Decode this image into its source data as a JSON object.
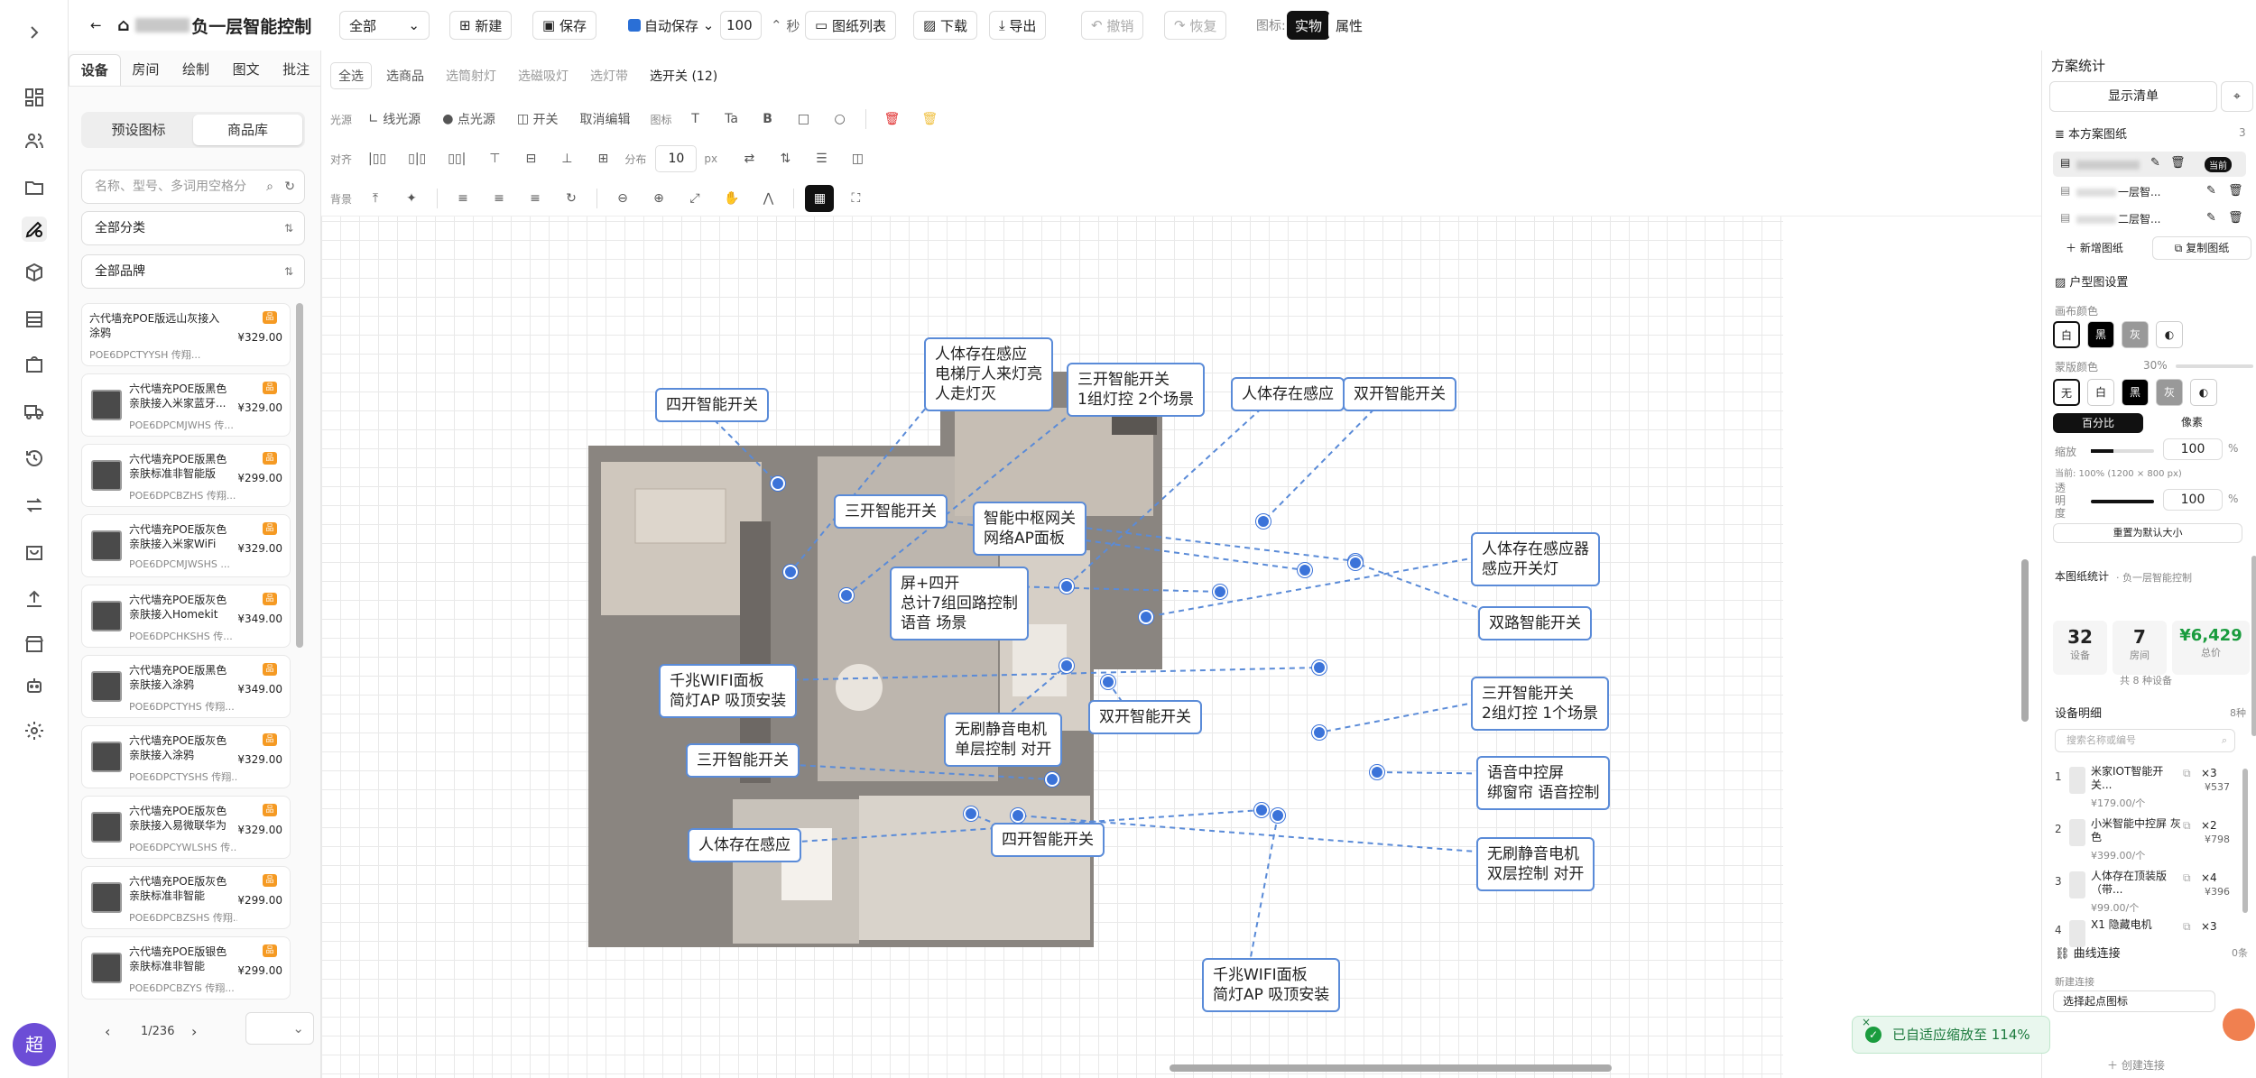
{
  "topbar": {
    "title": "负一层智能控制",
    "floor_select": "全部",
    "new": "新建",
    "save": "保存",
    "autosave": "自动保存",
    "interval": "100",
    "interval_unit": "秒",
    "drawing_list": "图纸列表",
    "download": "下载",
    "export": "导出",
    "undo": "撤销",
    "redo": "恢复",
    "icon_label": "图标:",
    "mode_real": "实物",
    "mode_attr": "属性"
  },
  "left": {
    "tabs": [
      "设备",
      "房间",
      "绘制",
      "图文",
      "批注"
    ],
    "seg": [
      "预设图标",
      "商品库"
    ],
    "search_placeholder": "名称、型号、多词用空格分",
    "category": "全部分类",
    "brand": "全部品牌",
    "page": "1/236",
    "products": [
      {
        "name": "六代墙充POE版远山灰接入涂鸦",
        "sku": "POE6DPCTYYSH 传翔...",
        "price": "¥329.00"
      },
      {
        "name": "六代墙充POE版黑色亲肤接入米家蓝牙...",
        "sku": "POE6DPCMJWHS 传...",
        "price": "¥329.00"
      },
      {
        "name": "六代墙充POE版黑色亲肤标准非智能版",
        "sku": "POE6DPCBZHS 传翔...",
        "price": "¥299.00"
      },
      {
        "name": "六代墙充POE版灰色亲肤接入米家WiFi",
        "sku": "POE6DPCMJWSHS ...",
        "price": "¥329.00"
      },
      {
        "name": "六代墙充POE版灰色亲肤接入Homekit",
        "sku": "POE6DPCHKSHS 传...",
        "price": "¥349.00"
      },
      {
        "name": "六代墙充POE版黑色亲肤接入涂鸦",
        "sku": "POE6DPCTYHS 传翔...",
        "price": "¥349.00"
      },
      {
        "name": "六代墙充POE版灰色亲肤接入涂鸦",
        "sku": "POE6DPCTYSHS 传翔...",
        "price": "¥329.00"
      },
      {
        "name": "六代墙充POE版灰色亲肤接入易微联华为",
        "sku": "POE6DPCYWLSHS 传...",
        "price": "¥329.00"
      },
      {
        "name": "六代墙充POE版灰色亲肤标准非智能",
        "sku": "POE6DPCBZSHS 传翔...",
        "price": "¥299.00"
      },
      {
        "name": "六代墙充POE版银色亲肤标准非智能",
        "sku": "POE6DPCBZYS 传翔...",
        "price": "¥299.00"
      }
    ]
  },
  "toolbar": {
    "r1": [
      "全选",
      "选商品",
      "选筒射灯",
      "选磁吸灯",
      "选灯带",
      "选开关 (12)"
    ],
    "r2": {
      "label": "光源",
      "items": [
        "线光源",
        "点光源",
        "开关",
        "取消编辑"
      ],
      "icon_label": "图标"
    },
    "r3": {
      "label": "对齐",
      "dist": "分布",
      "gap": "10",
      "unit": "px"
    },
    "r4": {
      "label": "背景"
    }
  },
  "labels": [
    {
      "t": "四开智能开关"
    },
    {
      "t": "人体存在感应\n电梯厅人来灯亮\n人走灯灭"
    },
    {
      "t": "三开智能开关\n1组灯控 2个场景"
    },
    {
      "t": "人体存在感应"
    },
    {
      "t": "双开智能开关"
    },
    {
      "t": "三开智能开关"
    },
    {
      "t": "智能中枢网关\n网络AP面板"
    },
    {
      "t": "屏+四开\n总计7组回路控制\n语音 场景"
    },
    {
      "t": "人体存在感应器\n感应开关灯"
    },
    {
      "t": "双路智能开关"
    },
    {
      "t": "千兆WIFI面板\n简灯AP 吸顶安装"
    },
    {
      "t": "三开智能开关\n2组灯控 1个场景"
    },
    {
      "t": "双开智能开关"
    },
    {
      "t": "无刷静音电机\n单层控制 对开"
    },
    {
      "t": "三开智能开关"
    },
    {
      "t": "语音中控屏\n绑窗帘 语音控制"
    },
    {
      "t": "人体存在感应"
    },
    {
      "t": "四开智能开关"
    },
    {
      "t": "无刷静音电机\n双层控制 对开"
    },
    {
      "t": "千兆WIFI面板\n简灯AP 吸顶安装"
    }
  ],
  "right": {
    "title": "方案统计",
    "show_list": "显示清单",
    "drawings": "本方案图纸",
    "drawings_count": "3",
    "current": "当前",
    "draw2": "一层智...",
    "draw3": "二层智...",
    "add_drawing": "新增图纸",
    "copy_drawing": "复制图纸",
    "plan_settings": "户型图设置",
    "canvas_color": "画布颜色",
    "mask_color": "蒙版颜色",
    "mask_pct": "30%",
    "colors": [
      "白",
      "黑",
      "灰"
    ],
    "mask_colors": [
      "无",
      "白",
      "黑",
      "灰"
    ],
    "percent": "百分比",
    "pixel": "像素",
    "scale": "缩放",
    "scale_val": "100",
    "current_size": "当前: 100% (1200 × 800 px)",
    "opacity": "透明度",
    "opacity_val": "100",
    "reset": "重置为默认大小",
    "stats_title": "本图纸统计",
    "stats_sub": "· 负一层智能控制",
    "devices": "32",
    "devices_l": "设备",
    "rooms": "7",
    "rooms_l": "房间",
    "price": "¥6,429",
    "price_l": "总价",
    "kinds": "共 8 种设备",
    "detail": "设备明细",
    "detail_count": "8种",
    "detail_search": "搜索名称或编号",
    "items": [
      {
        "n": "1",
        "name": "米家IOT智能开关...",
        "qty": "×3",
        "sub": "¥537",
        "unit": "¥179.00/个"
      },
      {
        "n": "2",
        "name": "小米智能中控屏 灰色",
        "qty": "×2",
        "sub": "¥798",
        "unit": "¥399.00/个"
      },
      {
        "n": "3",
        "name": "人体存在顶装版（带...",
        "qty": "×4",
        "sub": "¥396",
        "unit": "¥99.00/个"
      },
      {
        "n": "4",
        "name": "X1 隐藏电机",
        "qty": "×3",
        "sub": "",
        "unit": ""
      }
    ],
    "curve": "曲线连接",
    "curve_count": "0条",
    "new_conn": "新建连接",
    "start_icon": "选择起点图标",
    "create_conn": "创建连接"
  },
  "toast": "已自适应缩放至 114%",
  "avatar": "超",
  "colors": {
    "accent": "#3b73d9",
    "price": "#1a9c3e",
    "black": "#111111"
  }
}
